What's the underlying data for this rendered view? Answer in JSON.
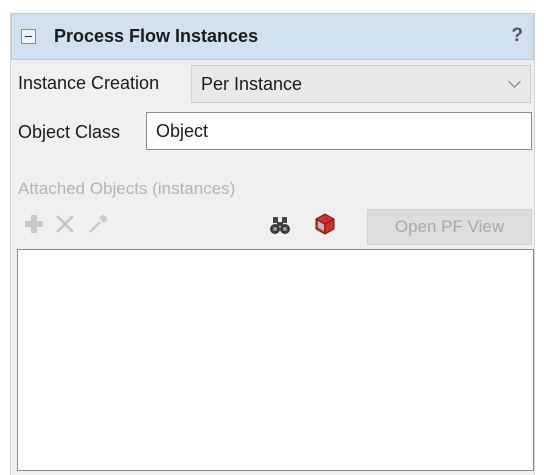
{
  "panel": {
    "title": "Process Flow Instances",
    "help": "?"
  },
  "instance_creation": {
    "label": "Instance Creation",
    "value": "Per Instance"
  },
  "object_class": {
    "label": "Object Class",
    "value": "Object"
  },
  "attached_objects": {
    "label": "Attached Objects (instances)",
    "open_button": "Open PF View",
    "items": []
  },
  "icons": {
    "collapse": "collapse-minus-icon",
    "add": "plus-icon",
    "remove": "close-x-icon",
    "sampler": "eyedropper-icon",
    "find": "binoculars-icon",
    "object": "red-cube-icon"
  }
}
